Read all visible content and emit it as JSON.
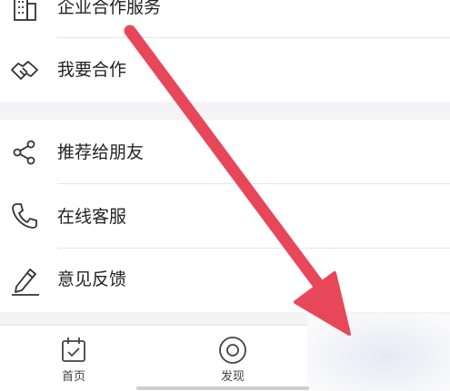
{
  "menu": {
    "items": [
      {
        "label": "企业合作服务",
        "icon": "building-icon"
      },
      {
        "label": "我要合作",
        "icon": "handshake-icon"
      },
      {
        "label": "推荐给朋友",
        "icon": "share-icon"
      },
      {
        "label": "在线客服",
        "icon": "phone-icon"
      },
      {
        "label": "意见反馈",
        "icon": "pencil-icon"
      }
    ]
  },
  "tabbar": {
    "tabs": [
      {
        "label": "首页",
        "icon": "calendar-icon"
      },
      {
        "label": "发现",
        "icon": "discover-icon"
      }
    ]
  },
  "colors": {
    "annotation_arrow": "#e8475a",
    "text": "#222222",
    "section_gap": "#f4f4f6"
  }
}
